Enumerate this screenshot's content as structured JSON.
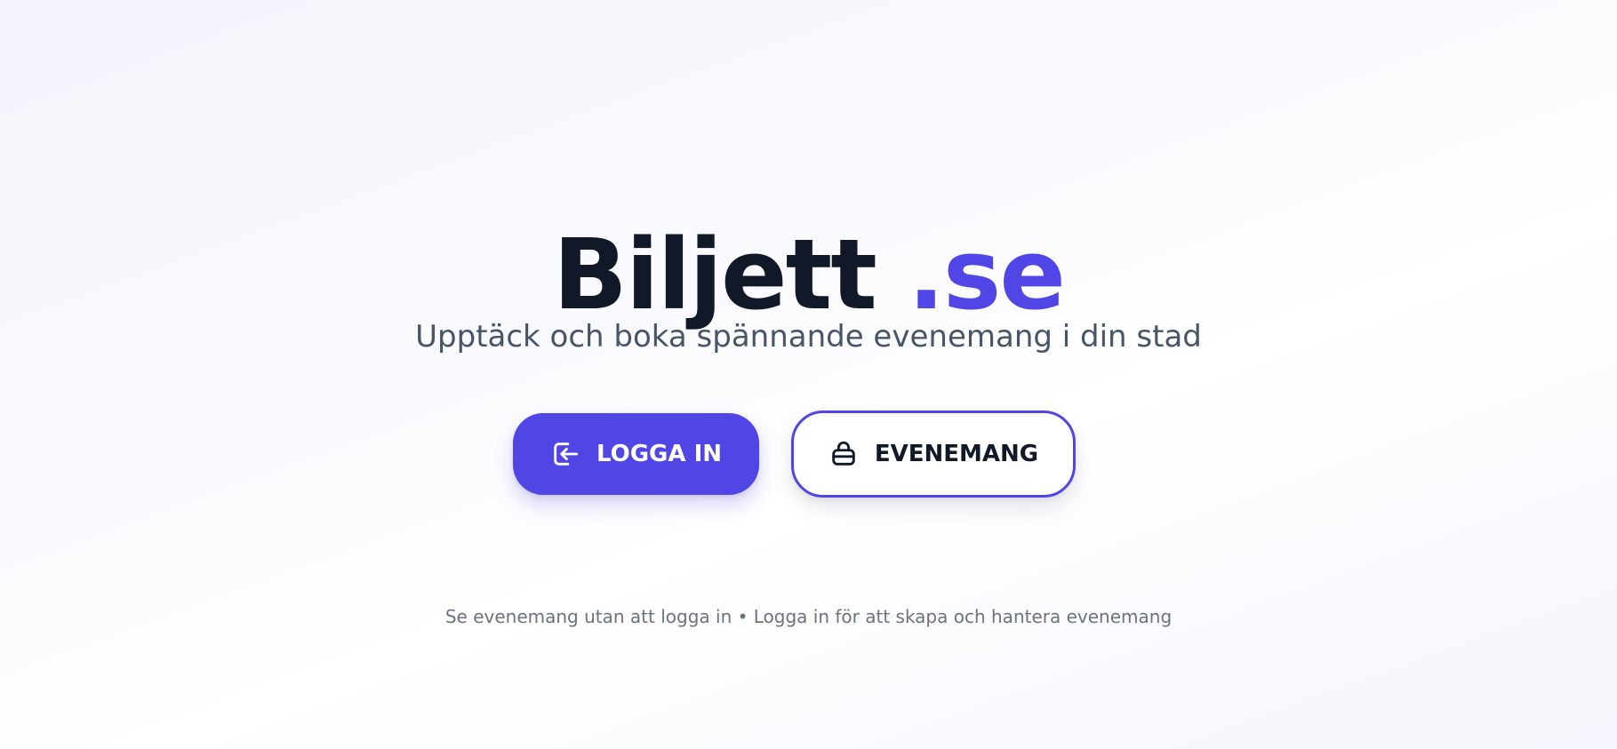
{
  "hero": {
    "title_main": "Biljett",
    "title_suffix": ".se",
    "subtitle": "Upptäck och boka spännande evenemang i din stad"
  },
  "actions": {
    "login": {
      "label": "LOGGA IN",
      "icon": "login-icon"
    },
    "events": {
      "label": "EVENEMANG",
      "icon": "ticket-icon"
    }
  },
  "footnote": "Se evenemang utan att logga in • Logga in för att skapa och hantera evenemang",
  "colors": {
    "accent": "#4f46e5",
    "heading": "#111827",
    "subtitle": "#475569",
    "muted": "#6b7280"
  }
}
